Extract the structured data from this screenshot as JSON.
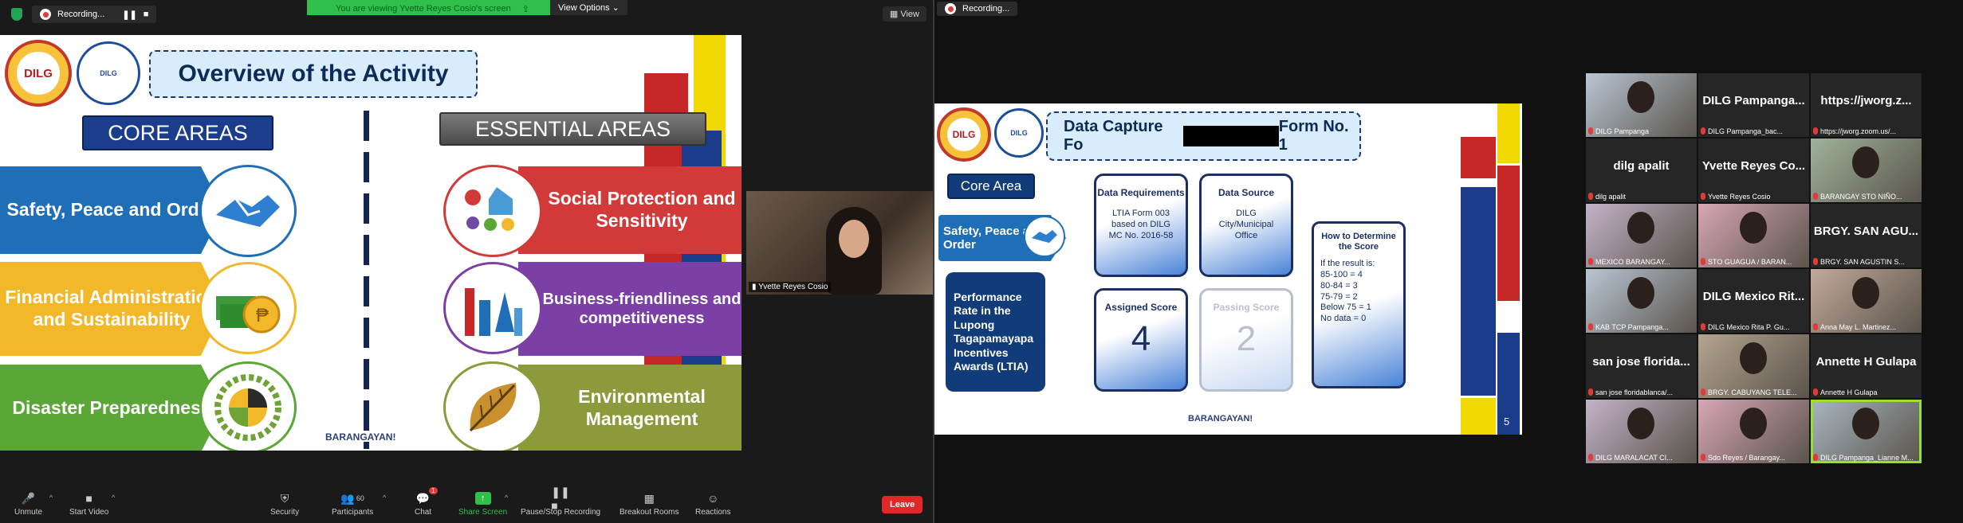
{
  "left": {
    "recording_label": "Recording...",
    "share_banner": "You are viewing Yvette Reyes Cosio's screen",
    "view_options": "View Options",
    "view_button": "View",
    "slide": {
      "dilg_logo_text": "DILG",
      "nbo_logo_text": "DILG",
      "title": "Overview of the Activity",
      "core_header": "CORE AREAS",
      "essential_header": "ESSENTIAL AREAS",
      "core_areas": [
        "Safety, Peace and Order",
        "Financial Administration and Sustainability",
        "Disaster Preparedness"
      ],
      "essential_areas": [
        "Social Protection and Sensitivity",
        "Business-friendliness and competitiveness",
        "Environmental Management"
      ],
      "footer_logo": "BARANGAYAN!"
    },
    "presenter_name": "Yvette Reyes Cosio",
    "toolbar": {
      "unmute": "Unmute",
      "start_video": "Start Video",
      "security": "Security",
      "participants": "Participants",
      "participants_count": "60",
      "chat": "Chat",
      "chat_badge": "1",
      "share_screen": "Share Screen",
      "pause_recording": "Pause/Stop Recording",
      "breakout": "Breakout Rooms",
      "reactions": "Reactions",
      "leave": "Leave"
    }
  },
  "right": {
    "recording_label": "Recording...",
    "slide": {
      "title_start": "Data Capture Fo",
      "title_end": "Form No. 1",
      "core_area_label": "Core Area",
      "core_area_value": "Safety, Peace and Order",
      "indicator": "Performance Rate in the Lupong Tagapamayapa Incentives Awards (LTIA)",
      "data_requirements_hd": "Data Requirements",
      "data_requirements": "LTIA Form 003 based on DILG MC No. 2016-58",
      "data_source_hd": "Data Source",
      "data_source": "DILG City/Municipal Office",
      "assigned_hd": "Assigned Score",
      "assigned_val": "4",
      "passing_hd": "Passing Score",
      "passing_val": "2",
      "howto_hd": "How to Determine the Score",
      "howto_rows": [
        "If the result is:",
        "85-100 = 4",
        "80-84 = 3",
        "75-79 = 2",
        "Below 75 = 1",
        "No data = 0"
      ],
      "page_number": "5",
      "footer_logo": "BARANGAYAN!"
    },
    "gallery": [
      {
        "name": "",
        "caption": "DILG Pampanga",
        "video": true
      },
      {
        "name": "DILG Pampanga...",
        "caption": "DILG Pampanga_bac...",
        "video": false
      },
      {
        "name": "https://jworg.z...",
        "caption": "https://jworg.zoom.us/...",
        "video": false
      },
      {
        "name": "dilg apalit",
        "caption": "dilg apalit",
        "video": false
      },
      {
        "name": "Yvette Reyes Co...",
        "caption": "Yvette Reyes Cosio",
        "video": false
      },
      {
        "name": "",
        "caption": "BARANGAY STO NIÑO...",
        "video": true
      },
      {
        "name": "",
        "caption": "MEXICO BARANGAY...",
        "video": true
      },
      {
        "name": "",
        "caption": "STO GUAGUA / BARAN...",
        "video": true
      },
      {
        "name": "BRGY. SAN AGU...",
        "caption": "BRGY. SAN AGUSTIN S...",
        "video": false
      },
      {
        "name": "",
        "caption": "KAB TCP Pampanga...",
        "video": true
      },
      {
        "name": "DILG Mexico Rit...",
        "caption": "DILG Mexico Rita P. Gu...",
        "video": false
      },
      {
        "name": "",
        "caption": "Anna May L. Martinez...",
        "video": true
      },
      {
        "name": "san jose florida...",
        "caption": "san jose floridablanca/...",
        "video": false
      },
      {
        "name": "",
        "caption": "BRGY. CABUYANG TELE...",
        "video": true
      },
      {
        "name": "Annette H Gulapa",
        "caption": "Annette H Gulapa",
        "video": false
      },
      {
        "name": "",
        "caption": "DILG MARALACAT CI...",
        "video": true
      },
      {
        "name": "",
        "caption": "Sdo Reyes / Barangay...",
        "video": true
      },
      {
        "name": "",
        "caption": "DILG Pampanga_Lianne M...",
        "video": true,
        "active": true
      }
    ]
  },
  "colors": {
    "safety_blue": "#1f6fb8",
    "finance_yellow": "#f2b829",
    "disaster_green": "#5aa636",
    "social_red": "#d23a3a",
    "business_purple": "#7b3fa6",
    "env_olive": "#8c9a3b",
    "leave_red": "#e02828",
    "share_green": "#2fbf4a"
  }
}
